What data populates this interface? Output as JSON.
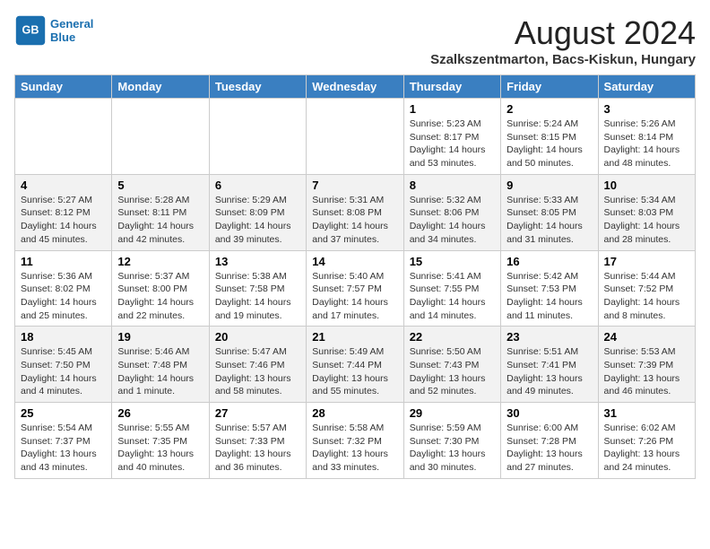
{
  "header": {
    "logo_line1": "General",
    "logo_line2": "Blue",
    "month_year": "August 2024",
    "location": "Szalkszentmarton, Bacs-Kiskun, Hungary"
  },
  "days_of_week": [
    "Sunday",
    "Monday",
    "Tuesday",
    "Wednesday",
    "Thursday",
    "Friday",
    "Saturday"
  ],
  "weeks": [
    [
      {
        "day": "",
        "info": ""
      },
      {
        "day": "",
        "info": ""
      },
      {
        "day": "",
        "info": ""
      },
      {
        "day": "",
        "info": ""
      },
      {
        "day": "1",
        "info": "Sunrise: 5:23 AM\nSunset: 8:17 PM\nDaylight: 14 hours\nand 53 minutes."
      },
      {
        "day": "2",
        "info": "Sunrise: 5:24 AM\nSunset: 8:15 PM\nDaylight: 14 hours\nand 50 minutes."
      },
      {
        "day": "3",
        "info": "Sunrise: 5:26 AM\nSunset: 8:14 PM\nDaylight: 14 hours\nand 48 minutes."
      }
    ],
    [
      {
        "day": "4",
        "info": "Sunrise: 5:27 AM\nSunset: 8:12 PM\nDaylight: 14 hours\nand 45 minutes."
      },
      {
        "day": "5",
        "info": "Sunrise: 5:28 AM\nSunset: 8:11 PM\nDaylight: 14 hours\nand 42 minutes."
      },
      {
        "day": "6",
        "info": "Sunrise: 5:29 AM\nSunset: 8:09 PM\nDaylight: 14 hours\nand 39 minutes."
      },
      {
        "day": "7",
        "info": "Sunrise: 5:31 AM\nSunset: 8:08 PM\nDaylight: 14 hours\nand 37 minutes."
      },
      {
        "day": "8",
        "info": "Sunrise: 5:32 AM\nSunset: 8:06 PM\nDaylight: 14 hours\nand 34 minutes."
      },
      {
        "day": "9",
        "info": "Sunrise: 5:33 AM\nSunset: 8:05 PM\nDaylight: 14 hours\nand 31 minutes."
      },
      {
        "day": "10",
        "info": "Sunrise: 5:34 AM\nSunset: 8:03 PM\nDaylight: 14 hours\nand 28 minutes."
      }
    ],
    [
      {
        "day": "11",
        "info": "Sunrise: 5:36 AM\nSunset: 8:02 PM\nDaylight: 14 hours\nand 25 minutes."
      },
      {
        "day": "12",
        "info": "Sunrise: 5:37 AM\nSunset: 8:00 PM\nDaylight: 14 hours\nand 22 minutes."
      },
      {
        "day": "13",
        "info": "Sunrise: 5:38 AM\nSunset: 7:58 PM\nDaylight: 14 hours\nand 19 minutes."
      },
      {
        "day": "14",
        "info": "Sunrise: 5:40 AM\nSunset: 7:57 PM\nDaylight: 14 hours\nand 17 minutes."
      },
      {
        "day": "15",
        "info": "Sunrise: 5:41 AM\nSunset: 7:55 PM\nDaylight: 14 hours\nand 14 minutes."
      },
      {
        "day": "16",
        "info": "Sunrise: 5:42 AM\nSunset: 7:53 PM\nDaylight: 14 hours\nand 11 minutes."
      },
      {
        "day": "17",
        "info": "Sunrise: 5:44 AM\nSunset: 7:52 PM\nDaylight: 14 hours\nand 8 minutes."
      }
    ],
    [
      {
        "day": "18",
        "info": "Sunrise: 5:45 AM\nSunset: 7:50 PM\nDaylight: 14 hours\nand 4 minutes."
      },
      {
        "day": "19",
        "info": "Sunrise: 5:46 AM\nSunset: 7:48 PM\nDaylight: 14 hours\nand 1 minute."
      },
      {
        "day": "20",
        "info": "Sunrise: 5:47 AM\nSunset: 7:46 PM\nDaylight: 13 hours\nand 58 minutes."
      },
      {
        "day": "21",
        "info": "Sunrise: 5:49 AM\nSunset: 7:44 PM\nDaylight: 13 hours\nand 55 minutes."
      },
      {
        "day": "22",
        "info": "Sunrise: 5:50 AM\nSunset: 7:43 PM\nDaylight: 13 hours\nand 52 minutes."
      },
      {
        "day": "23",
        "info": "Sunrise: 5:51 AM\nSunset: 7:41 PM\nDaylight: 13 hours\nand 49 minutes."
      },
      {
        "day": "24",
        "info": "Sunrise: 5:53 AM\nSunset: 7:39 PM\nDaylight: 13 hours\nand 46 minutes."
      }
    ],
    [
      {
        "day": "25",
        "info": "Sunrise: 5:54 AM\nSunset: 7:37 PM\nDaylight: 13 hours\nand 43 minutes."
      },
      {
        "day": "26",
        "info": "Sunrise: 5:55 AM\nSunset: 7:35 PM\nDaylight: 13 hours\nand 40 minutes."
      },
      {
        "day": "27",
        "info": "Sunrise: 5:57 AM\nSunset: 7:33 PM\nDaylight: 13 hours\nand 36 minutes."
      },
      {
        "day": "28",
        "info": "Sunrise: 5:58 AM\nSunset: 7:32 PM\nDaylight: 13 hours\nand 33 minutes."
      },
      {
        "day": "29",
        "info": "Sunrise: 5:59 AM\nSunset: 7:30 PM\nDaylight: 13 hours\nand 30 minutes."
      },
      {
        "day": "30",
        "info": "Sunrise: 6:00 AM\nSunset: 7:28 PM\nDaylight: 13 hours\nand 27 minutes."
      },
      {
        "day": "31",
        "info": "Sunrise: 6:02 AM\nSunset: 7:26 PM\nDaylight: 13 hours\nand 24 minutes."
      }
    ]
  ]
}
